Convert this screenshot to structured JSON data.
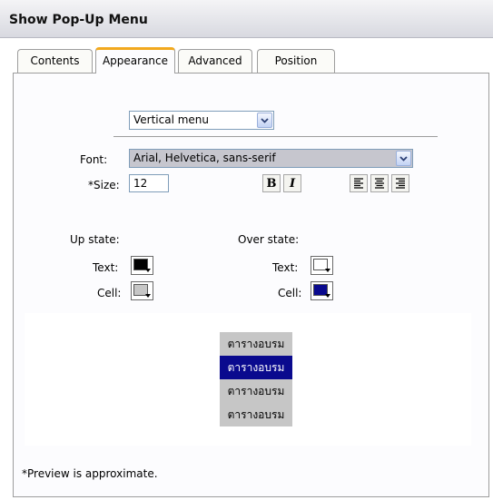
{
  "window": {
    "title": "Show Pop-Up Menu"
  },
  "tabs": [
    {
      "label": "Contents",
      "active": false
    },
    {
      "label": "Appearance",
      "active": true
    },
    {
      "label": "Advanced",
      "active": false
    },
    {
      "label": "Position",
      "active": false
    }
  ],
  "appearance": {
    "menu_type": "Vertical menu",
    "font_label": "Font:",
    "font_value": "Arial, Helvetica, sans-serif",
    "size_label": "*Size:",
    "size_value": "12",
    "bold_label": "B",
    "italic_label": "I"
  },
  "states": {
    "up_state_label": "Up state:",
    "over_state_label": "Over state:",
    "text_label": "Text:",
    "cell_label": "Cell:",
    "up_text_color": "#000000",
    "up_cell_color": "#c6c6c6",
    "over_text_color": "#ffffff",
    "over_cell_color": "#0a0a8e"
  },
  "preview": {
    "items": [
      {
        "label": "ตารางอบรม",
        "hover": false
      },
      {
        "label": "ตารางอบรม",
        "hover": true
      },
      {
        "label": "ตารางอบรม",
        "hover": false
      },
      {
        "label": "ตารางอบรม",
        "hover": false
      }
    ],
    "note": "*Preview is approximate."
  }
}
